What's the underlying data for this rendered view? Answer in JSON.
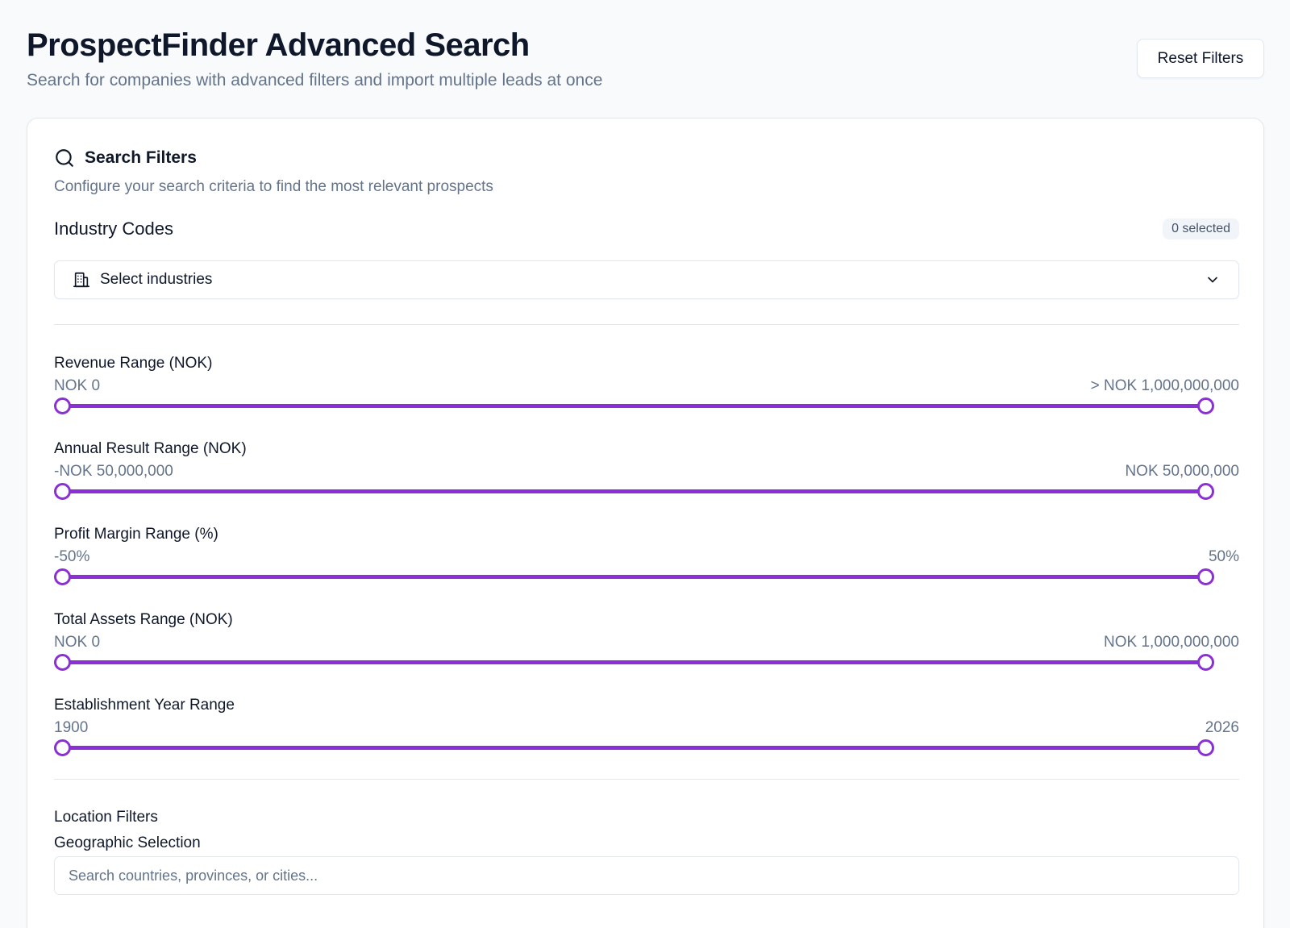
{
  "header": {
    "title": "ProspectFinder Advanced Search",
    "subtitle": "Search for companies with advanced filters and import multiple leads at once",
    "reset_label": "Reset Filters"
  },
  "filters": {
    "title": "Search Filters",
    "description": "Configure your search criteria to find the most relevant prospects",
    "industry": {
      "label": "Industry Codes",
      "badge": "0 selected",
      "select_placeholder": "Select industries"
    },
    "ranges": [
      {
        "label": "Revenue Range (NOK)",
        "min_text": "NOK 0",
        "max_text": "> NOK 1,000,000,000",
        "low_fraction": 0,
        "high_fraction": 1
      },
      {
        "label": "Annual Result Range (NOK)",
        "min_text": "-NOK 50,000,000",
        "max_text": "NOK 50,000,000",
        "low_fraction": 0,
        "high_fraction": 1
      },
      {
        "label": "Profit Margin Range (%)",
        "min_text": "-50%",
        "max_text": "50%",
        "low_fraction": 0,
        "high_fraction": 1
      },
      {
        "label": "Total Assets Range (NOK)",
        "min_text": "NOK 0",
        "max_text": "NOK 1,000,000,000",
        "low_fraction": 0,
        "high_fraction": 1
      },
      {
        "label": "Establishment Year Range",
        "min_text": "1900",
        "max_text": "2026",
        "low_fraction": 0,
        "high_fraction": 1
      }
    ],
    "location": {
      "title": "Location Filters",
      "geo_label": "Geographic Selection",
      "geo_placeholder": "Search countries, provinces, or cities..."
    }
  },
  "colors": {
    "accent": "#8b2fd6",
    "muted_text": "#64748b",
    "border": "#e2e8f0"
  },
  "icons": {
    "filters": "search-icon",
    "industry_select": "building-icon",
    "dropdown": "chevron-down-icon"
  }
}
